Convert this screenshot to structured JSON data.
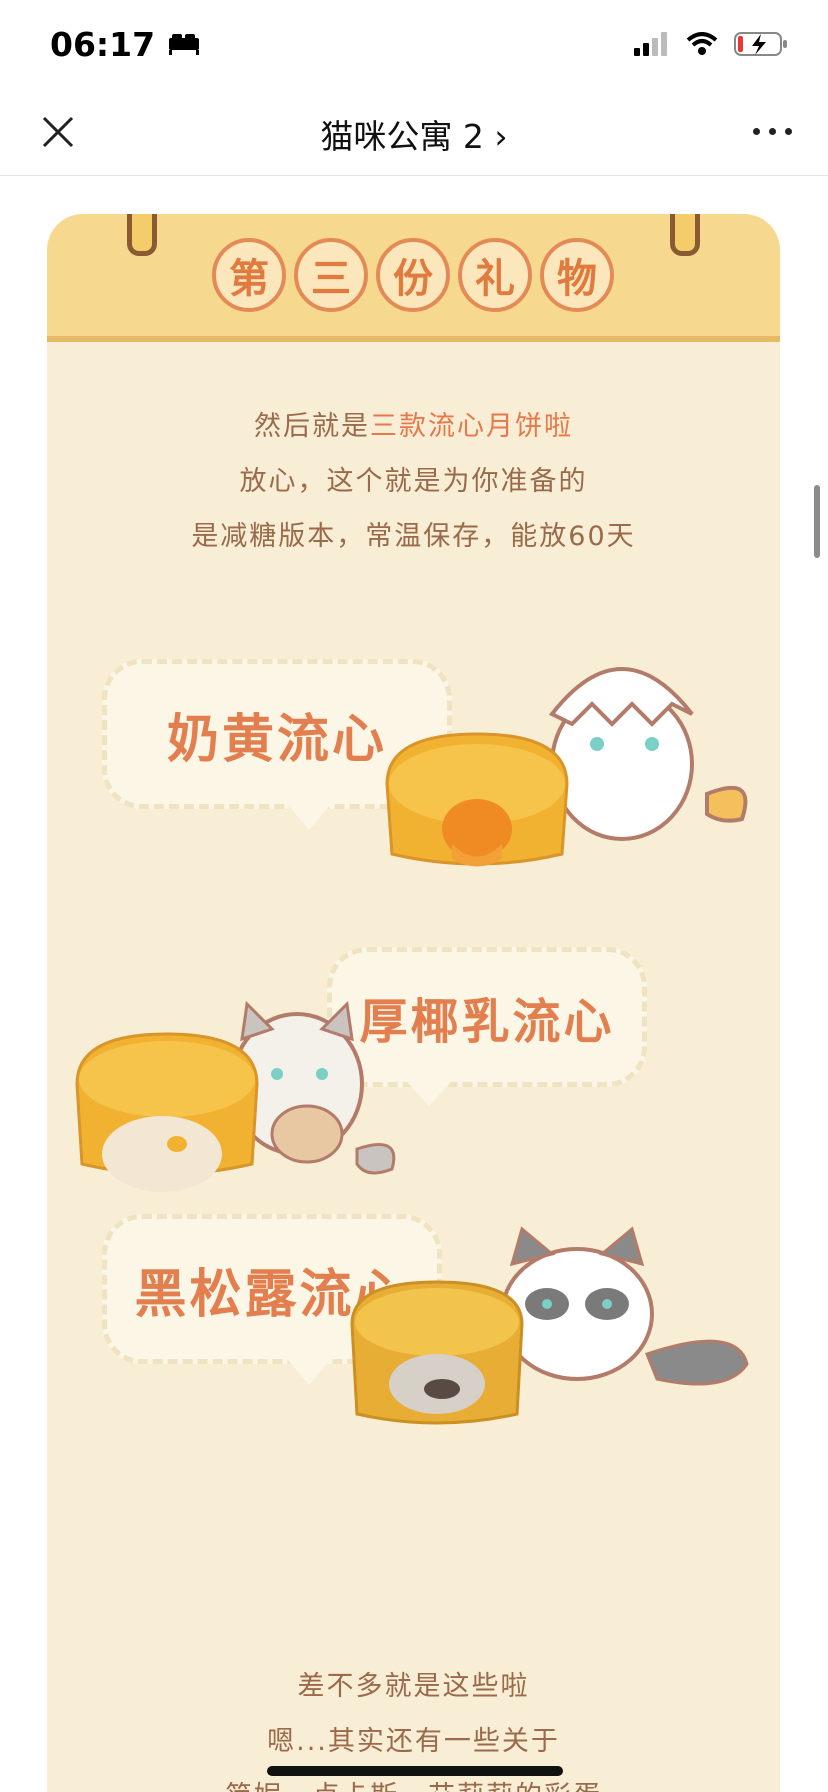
{
  "status_bar": {
    "time": "06:17",
    "icons": [
      "bed-icon",
      "signal-icon",
      "wifi-icon",
      "battery-charging-icon"
    ]
  },
  "nav": {
    "title": "猫咪公寓 2",
    "chevron": "›",
    "close_icon": "close-icon",
    "more_icon": "more-icon"
  },
  "card": {
    "title_chars": [
      "第",
      "三",
      "份",
      "礼",
      "物"
    ],
    "intro": {
      "line1_prefix": "然后就是",
      "line1_highlight": "三款流心月饼啦",
      "line2": "放心，这个就是为你准备的",
      "line3": "是减糖版本，常温保存，能放60天"
    },
    "flavors": [
      {
        "label": "奶黄流心"
      },
      {
        "label": "厚椰乳流心"
      },
      {
        "label": "黑松露流心"
      }
    ],
    "outro": {
      "line1": "差不多就是这些啦",
      "line2": "嗯...其实还有一些关于",
      "line3": "简妮、卢卡斯、艾莉莉的彩蛋"
    }
  },
  "colors": {
    "header": "#f6d98f",
    "card_bg": "#f8eed6",
    "accent": "#e37f4f",
    "text": "#9a6a4a"
  }
}
